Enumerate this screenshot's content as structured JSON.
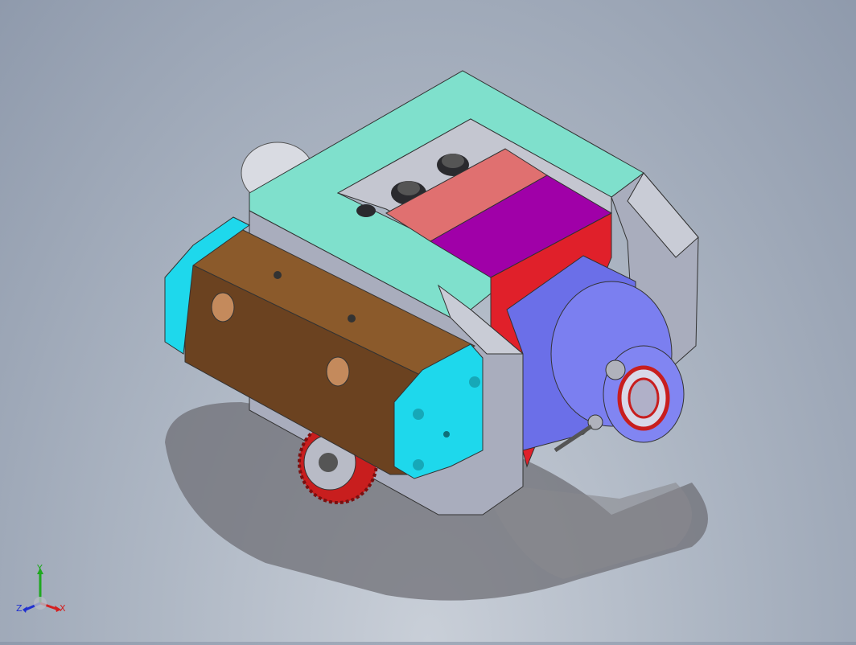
{
  "viewport": {
    "background_top": "#8f9aac",
    "background_bottom": "#c9cfd8",
    "model": {
      "colors": {
        "frame_top": "#7fe0cc",
        "frame_side": "#a9adbd",
        "brown_block": "#8b5a2b",
        "brown_block_dark": "#6b4220",
        "cyan_plate": "#1ed8ec",
        "pink_block": "#e07070",
        "magenta_block": "#a000a8",
        "red_block": "#e0202a",
        "motor_blue": "#6b6fe8",
        "gear_red": "#c81e1e",
        "hex_nut": "#2a2a2e"
      }
    }
  },
  "triad": {
    "y_label": "Y",
    "x_label": "X",
    "z_label": "Z",
    "y_color": "#1fa81f",
    "x_color": "#d42020",
    "z_color": "#2030d0"
  }
}
